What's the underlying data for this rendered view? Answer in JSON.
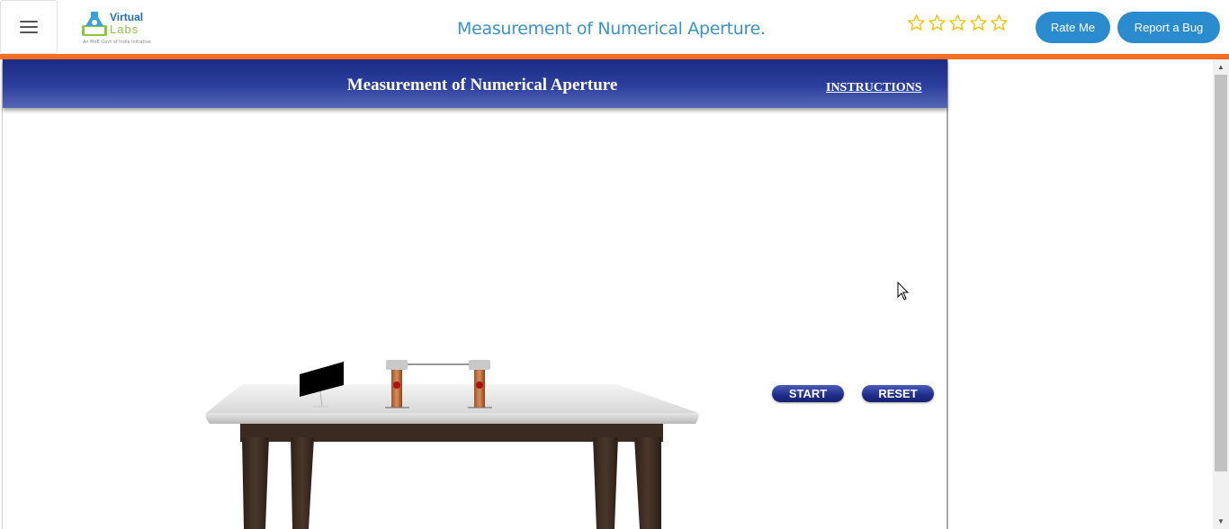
{
  "navbar": {
    "menu_icon": "hamburger-menu-icon",
    "logo": {
      "line1": "Virtual",
      "line2": "Labs",
      "tagline": "An MoE Govt of India Initiative"
    },
    "title": "Measurement of Numerical Aperture.",
    "rating": {
      "stars": 5,
      "filled": 0,
      "icon": "star-outline-icon",
      "color": "#f2c200"
    },
    "rate_label": "Rate Me",
    "bug_label": "Report a Bug"
  },
  "simulation": {
    "title": "Measurement of Numerical Aperture",
    "instructions_label": "INSTRUCTIONS",
    "start_label": "START",
    "reset_label": "RESET"
  },
  "colors": {
    "accent_orange": "#f26f21",
    "button_blue": "#2a8ccf",
    "header_navy": "#1b2a86",
    "title_blue": "#3a92c8"
  },
  "scrollbar": {
    "up_icon": "scroll-up-arrow-icon",
    "down_icon": "scroll-down-arrow-icon"
  }
}
